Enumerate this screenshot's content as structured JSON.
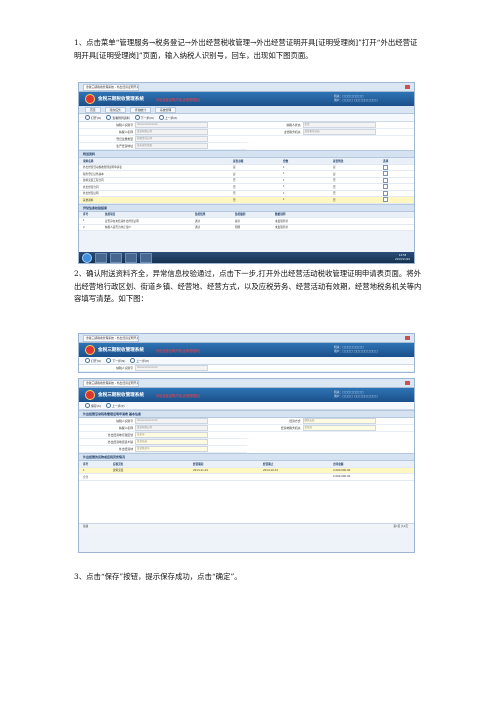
{
  "step1": "1、点击菜单“管理服务→税务登记→外出经营税收管理→外出经营证明开具[证明受理岗]”打开“外出经营证明开具[证明受理岗]”页面，输入纳税人识别号，回车，出现如下图页面。",
  "step2": "2、确认附送资料齐全，异常信息校验通过，点击下一步,打开外出经营活动税收管理证明申请表页面。将外出经营地行政区划、街道乡镇、经营地、经营方式，以及应税劳务、经营活动有效期，经营地税务机关等内容填写清楚。如下图：",
  "step3": "3、点击“保存”按钮，提示保存成功，点击“确定”。",
  "app": {
    "window_title": "金税三期税收管理系统 - 外出经营证明开具",
    "system_name": "金税三期税收管理系统",
    "banner_red": "外出经营证明开具[证明受理岗]",
    "user_line1": "机关：□□□□□□□□",
    "user_line2": "用户：□□□□  □□□□□□□□□",
    "menu": [
      "首页",
      "待办任务",
      "查询统计",
      "系统管理"
    ],
    "toolbar": [
      "下一步(N)",
      "上一步(P)",
      "保存(S)"
    ],
    "radio_labels": [
      "打开(O)",
      "查看附列资料"
    ],
    "fields1": [
      {
        "label": "纳税人识别号",
        "value": "4xxxxxxxxxxxxx"
      },
      {
        "label": "纳税人名称",
        "value": "某某有限公司"
      },
      {
        "label": "登记注册类型",
        "value": "有限责任公司"
      },
      {
        "label": "生产经营地址",
        "value": "某市某区某路"
      }
    ],
    "fields1_right": [
      {
        "label": "纳税人状态",
        "value": "正常"
      },
      {
        "label": "主管税务机关",
        "value": "某某税务分局"
      }
    ],
    "section_docs": "附送资料",
    "docs_header": [
      "资料名称",
      "是否必报",
      "份数",
      "是否附送",
      "选择"
    ],
    "docs": [
      [
        "外出经营活动税收管理证明申请表",
        "是",
        "1",
        "是"
      ],
      [
        "税务登记证件副本",
        "是",
        "1",
        "是"
      ],
      [
        "建筑安装工程合同",
        "否",
        "1",
        "否"
      ],
      [
        "外出经营合同",
        "否",
        "1",
        "否"
      ],
      [
        "外出经营证明",
        "否",
        "1",
        "否"
      ],
      [
        "其他资料",
        "否",
        "1",
        "否"
      ]
    ],
    "section_check": "异常信息校验结果",
    "check_header": [
      "序号",
      "监控项目",
      "监控结果",
      "监控级别",
      "数据说明"
    ],
    "checks": [
      [
        "1",
        "是否存在未结清外出经营证明",
        "通过",
        "提示",
        "未发现异常"
      ],
      [
        "2",
        "纳税人是否为非正常户",
        "通过",
        "阻断",
        "未发现异常"
      ]
    ],
    "clock_time": "14:55",
    "clock_date": "2013/11/01",
    "section_form": "外出经营活动税收管理证明申请表 基本信息",
    "form_fields": [
      {
        "label": "纳税人识别号",
        "value": "4xxxxxxxxxxxxx"
      },
      {
        "label": "纳税人名称",
        "value": "某某有限公司"
      },
      {
        "label": "外出经营地行政区划",
        "value": "某某市"
      },
      {
        "label": "外出经营地街道乡镇",
        "value": "某某街道"
      },
      {
        "label": "外出经营地",
        "value": "某某路某号"
      },
      {
        "label": "经营方式",
        "value": "建筑安装"
      },
      {
        "label": "经营地税务机关",
        "value": "某某局"
      }
    ],
    "section_goods": "外出经营的货物或应税劳务情况",
    "goods_header": [
      "序号",
      "应税劳务",
      "经营期起",
      "经营期止",
      "合同金额"
    ],
    "goods": [
      [
        "1",
        "建筑安装",
        "2013-11-01",
        "2014-10-31",
        "2,000,000.00"
      ]
    ],
    "goods_total": [
      "合计",
      "2,000,000.00"
    ],
    "footer_left": "就绪",
    "footer_right": "第1页 共1页"
  }
}
